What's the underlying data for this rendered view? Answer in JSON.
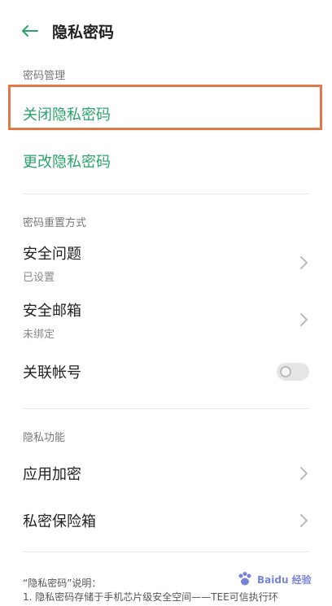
{
  "header": {
    "title": "隐私密码"
  },
  "sections": {
    "password_management": {
      "label": "密码管理",
      "items": {
        "close": "关闭隐私密码",
        "change": "更改隐私密码"
      }
    },
    "reset": {
      "label": "密码重置方式",
      "items": {
        "security_question": {
          "label": "安全问题",
          "sub": "已设置"
        },
        "security_email": {
          "label": "安全邮箱",
          "sub": "未绑定"
        },
        "linked_account": {
          "label": "关联帐号"
        }
      }
    },
    "privacy": {
      "label": "隐私功能",
      "items": {
        "app_encryption": "应用加密",
        "private_vault": "私密保险箱"
      }
    }
  },
  "explanation": {
    "title": "“隐私密码”说明：",
    "line1": "1. 隐私密码存储于手机芯片级安全空间——TEE可信执行环"
  },
  "watermark": {
    "text": "Baidu 经验"
  },
  "colors": {
    "accent": "#2aa36b",
    "highlight": "#e0784a"
  }
}
